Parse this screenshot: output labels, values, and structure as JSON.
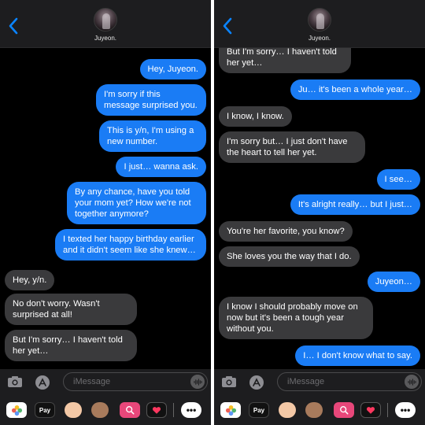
{
  "contact": {
    "name": "Juyeon."
  },
  "input": {
    "placeholder": "iMessage"
  },
  "app_strip": {
    "pay_label": "Pay",
    "more_label": "•••"
  },
  "colors": {
    "outgoing": "#1a7cf5",
    "incoming": "#3a3a3c",
    "background": "#000000",
    "accent": "#0a84ff"
  },
  "icons": [
    "chevron-left-icon",
    "camera-icon",
    "app-store-icon",
    "audio-waveform-icon",
    "photos-icon",
    "apple-pay-icon",
    "memoji-icon",
    "search-images-icon",
    "digital-touch-icon",
    "more-icon"
  ],
  "left_messages": [
    {
      "dir": "out",
      "text": "Hey, Juyeon."
    },
    {
      "dir": "out",
      "text": "I'm sorry if this message surprised you."
    },
    {
      "dir": "out",
      "text": "This is y/n, I'm using a new number."
    },
    {
      "dir": "out",
      "text": "I just… wanna ask."
    },
    {
      "dir": "out",
      "text": "By any chance, have you told your mom yet? How we're not together anymore?"
    },
    {
      "dir": "out",
      "text": "I texted her happy birthday earlier and it didn't seem like she knew…"
    },
    {
      "dir": "in",
      "text": "Hey, y/n."
    },
    {
      "dir": "in",
      "text": "No don't worry. Wasn't surprised at all!"
    },
    {
      "dir": "in",
      "text": "But I'm sorry… I haven't told her yet…"
    }
  ],
  "right_messages": [
    {
      "dir": "in",
      "text": "But I'm sorry… I haven't told her yet…"
    },
    {
      "dir": "out",
      "text": "Ju… it's been a whole year…"
    },
    {
      "dir": "in",
      "text": "I know, I know."
    },
    {
      "dir": "in",
      "text": "I'm sorry but… I just don't have the heart to tell her yet."
    },
    {
      "dir": "out",
      "text": "I see…"
    },
    {
      "dir": "out",
      "text": "It's alright really… but I just…"
    },
    {
      "dir": "in",
      "text": "You're her favorite, you know?"
    },
    {
      "dir": "in",
      "text": "She loves you the way that I do."
    },
    {
      "dir": "out",
      "text": "Juyeon…"
    },
    {
      "dir": "in",
      "text": "I know I should probably move on now but it's been a tough year without you."
    },
    {
      "dir": "out",
      "text": "I… I don't know what to say."
    }
  ]
}
